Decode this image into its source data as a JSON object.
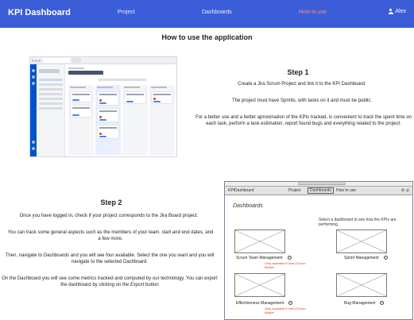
{
  "navbar": {
    "brand": "KPI Dashboard",
    "links": [
      {
        "label": "Project"
      },
      {
        "label": "Dashboards"
      },
      {
        "label": "How to use",
        "active": true
      }
    ],
    "user": "Alex",
    "accent_color": "#3c5dd8",
    "active_color": "#ff8a7a"
  },
  "page": {
    "title": "How to use the application"
  },
  "step1": {
    "heading": "Step 1",
    "p1": "Create a Jira Scrum Project and link it to the KPI Dashboard.",
    "p2": "The project must have Sprints, with tasks on it and must be public.",
    "p3": "For a better use and a better aproximation of the KPIs tracked, is convenient to track the spent time on each task, perform a task estimation, report found bugs and everything related to the project.",
    "screenshot_icon": "jira-kanban-board-screenshot"
  },
  "step2": {
    "heading": "Step 2",
    "p1": "Once you have logged in, check if your project corresponds to the Jira Board project.",
    "p2": "You can track some general aspects such as the members of your team, start and end dates, and a few more.",
    "p3_before": "Then, navigate to ",
    "p3_em": "Dashboards",
    "p3_after": " and you will see four available. Select the one you want and you will navigate to the selected Dashboard.",
    "p4_before": "On the Dashboard you will see some metrics tracked and computed by our technology. You can export the dashboard by clicking on the ",
    "p4_em": "Export",
    "p4_after": " button",
    "wireframe": {
      "nav": [
        "KPIDashboard",
        "Project",
        "Dashboards",
        "How to use"
      ],
      "title": "Dashboards",
      "select_text": "Select a dashboard to see how the KPIs are performing",
      "cards": [
        {
          "label": "Scrum Team Management",
          "note": "Only available if user |SCrum Master"
        },
        {
          "label": "Sprint Management",
          "note": ""
        },
        {
          "label": "Effectiveness Management",
          "note": "Only available if user |SCrum Master"
        },
        {
          "label": "Bug Management",
          "note": ""
        }
      ]
    }
  }
}
